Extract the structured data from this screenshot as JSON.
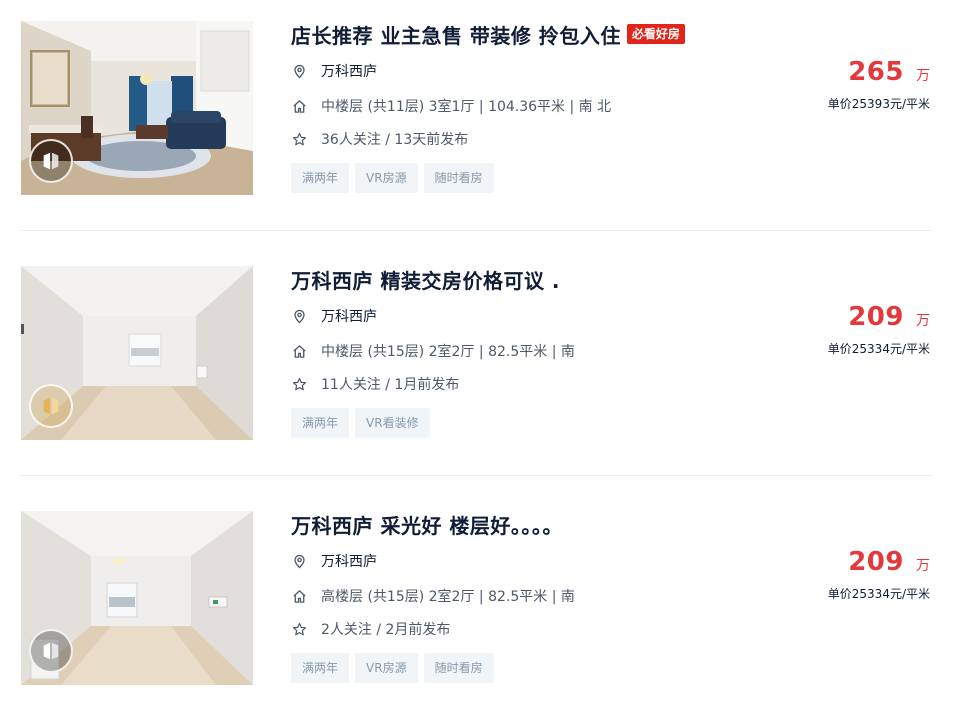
{
  "listings": [
    {
      "title": "店长推荐 业主急售 带装修 拎包入住",
      "hot_tag": "必看好房",
      "community": "万科西庐",
      "house_info": "中楼层 (共11层) 3室1厅 | 104.36平米 | 南 北",
      "follow_info": "36人关注 / 13天前发布",
      "tags": [
        "满两年",
        "VR房源",
        "随时看房"
      ],
      "total_price": "265",
      "total_unit": "万",
      "unit_price": "单价25393元/平米"
    },
    {
      "title": "万科西庐 精装交房价格可议 .",
      "hot_tag": "",
      "community": "万科西庐",
      "house_info": "中楼层 (共15层) 2室2厅 | 82.5平米 | 南",
      "follow_info": "11人关注 / 1月前发布",
      "tags": [
        "满两年",
        "VR看装修"
      ],
      "total_price": "209",
      "total_unit": "万",
      "unit_price": "单价25334元/平米"
    },
    {
      "title": "万科西庐 采光好 楼层好。。。。",
      "hot_tag": "",
      "community": "万科西庐",
      "house_info": "高楼层 (共15层) 2室2厅 | 82.5平米 | 南",
      "follow_info": "2人关注 / 2月前发布",
      "tags": [
        "满两年",
        "VR房源",
        "随时看房"
      ],
      "total_price": "209",
      "total_unit": "万",
      "unit_price": "单价25334元/平米"
    }
  ],
  "colors": {
    "price": "#e4393c",
    "hot_tag_bg": "#e1251b",
    "title": "#101d37",
    "tag_bg": "#f2f5f7",
    "tag_text": "#849aae"
  },
  "icons": {
    "address": "location-pin-icon",
    "house": "house-icon",
    "follow": "star-icon",
    "vr": "vr-logo-icon"
  }
}
